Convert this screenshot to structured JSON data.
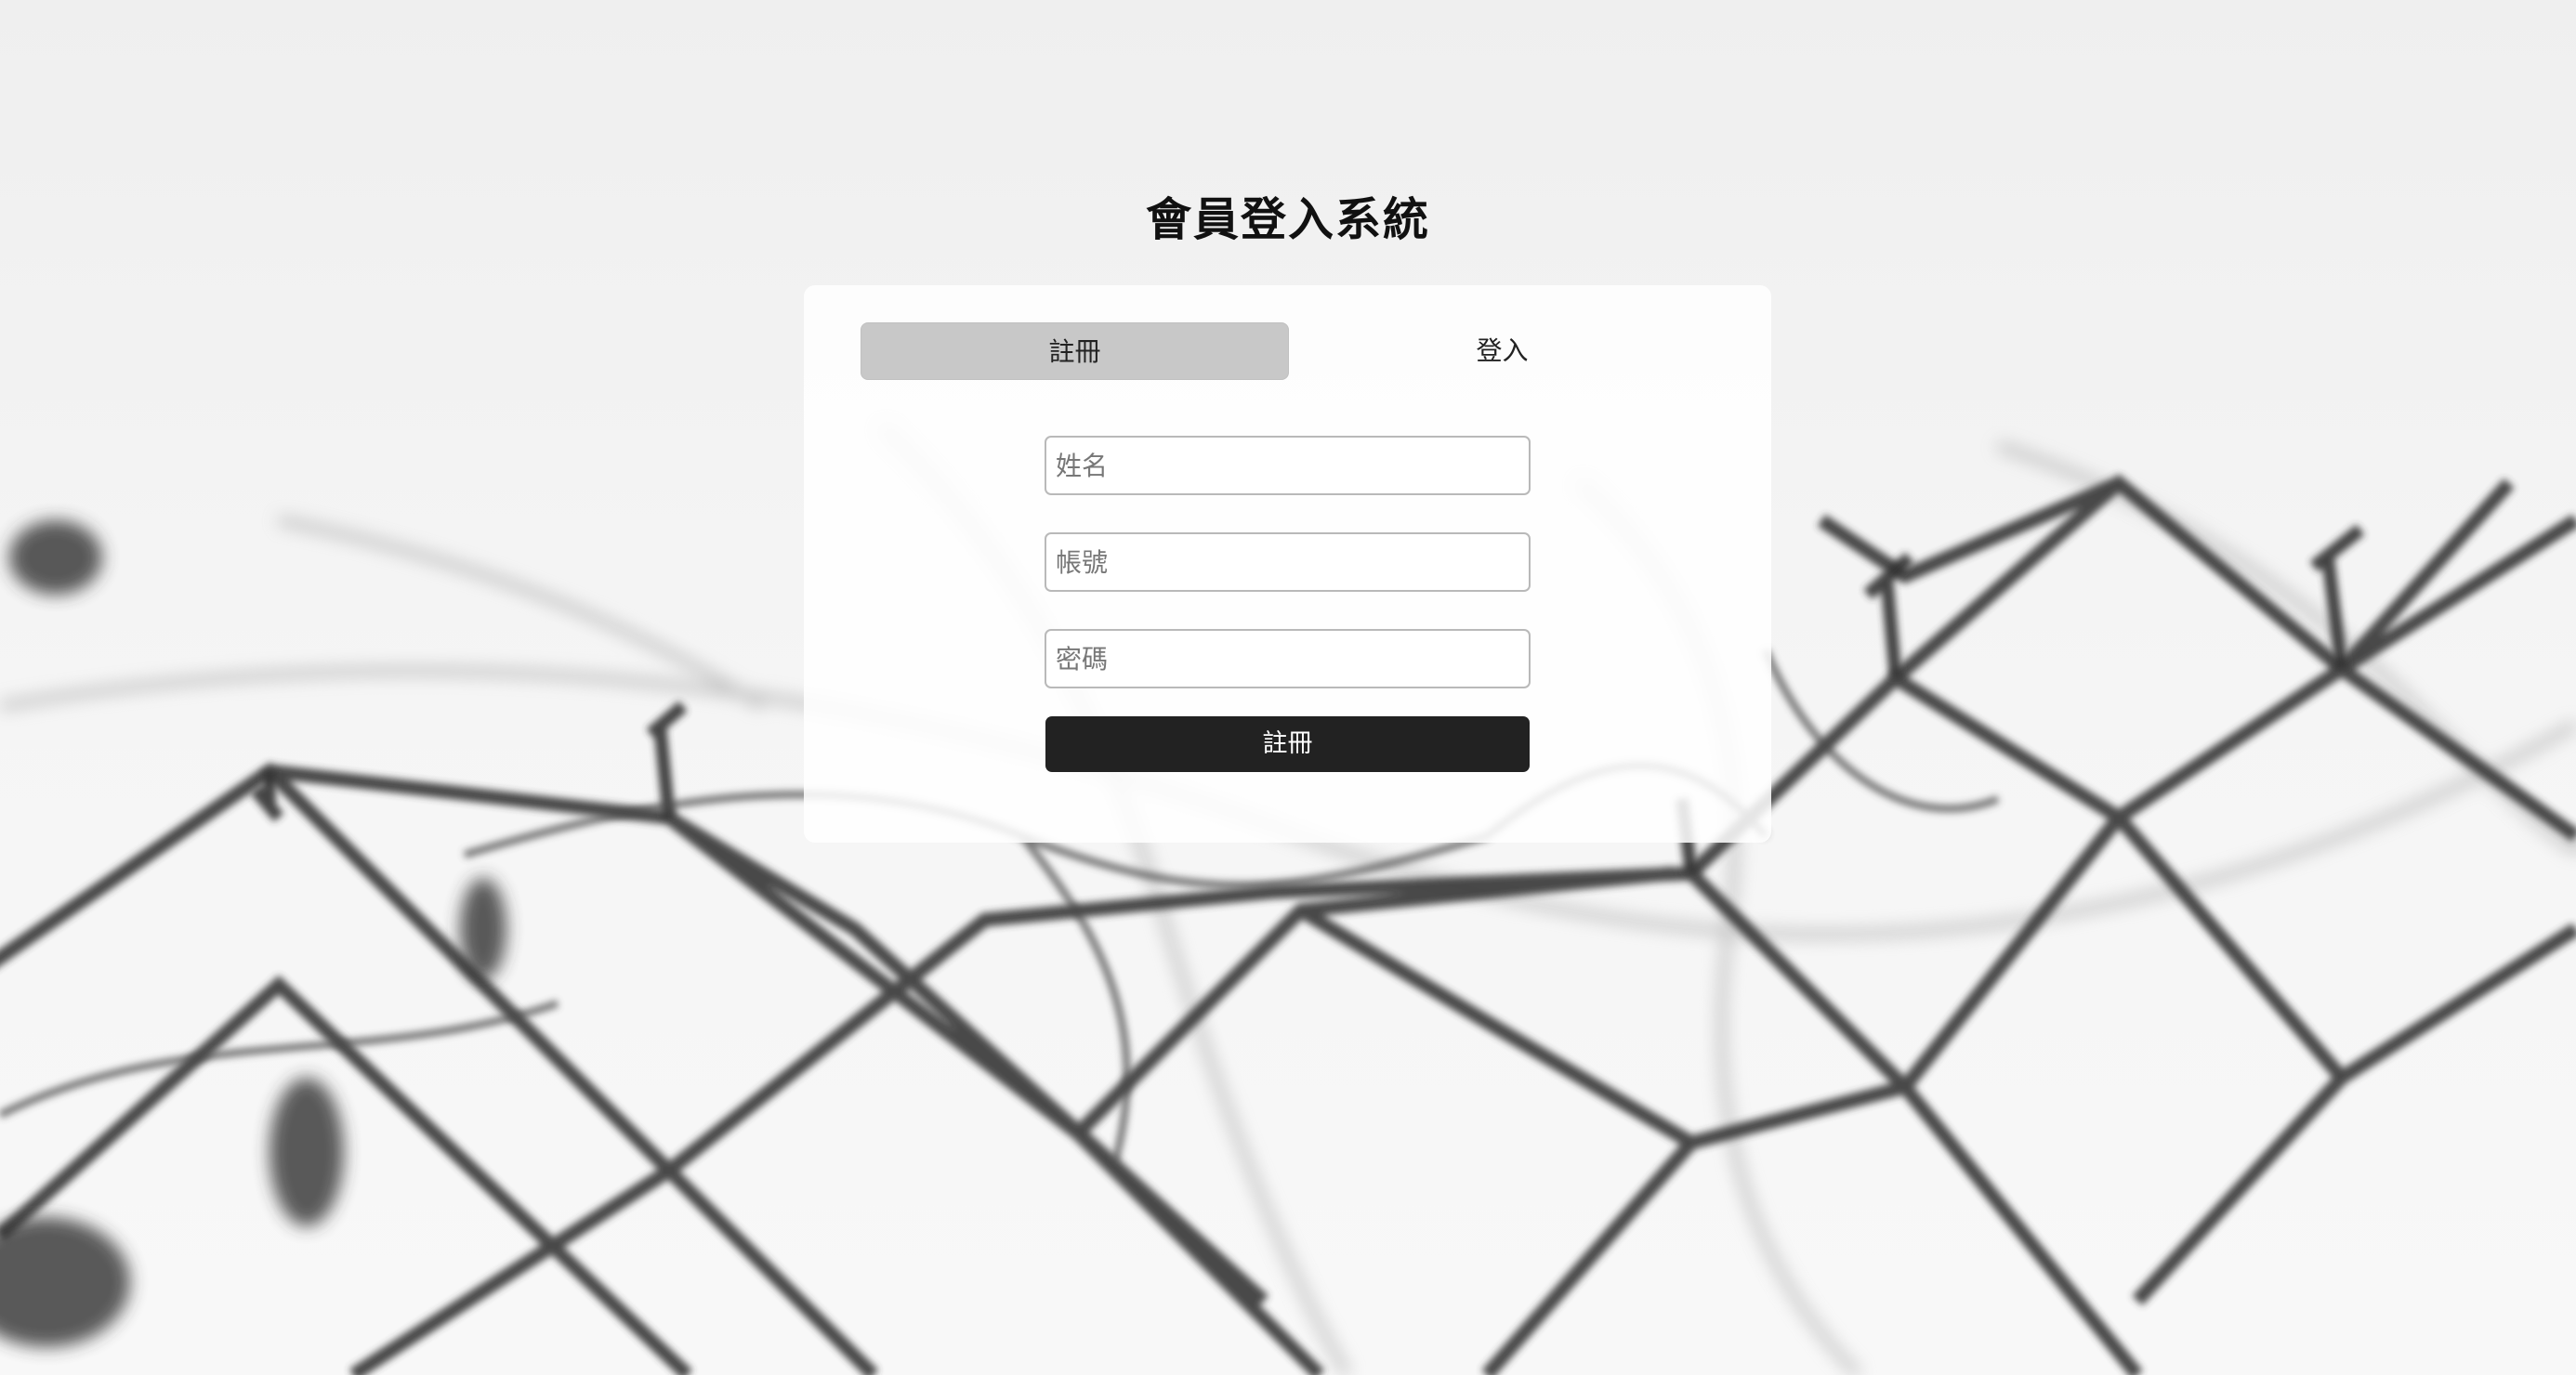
{
  "page": {
    "title": "會員登入系統"
  },
  "tabs": [
    {
      "label": "註冊",
      "active": true
    },
    {
      "label": "登入",
      "active": false
    }
  ],
  "form": {
    "name_placeholder": "姓名",
    "account_placeholder": "帳號",
    "password_placeholder": "密碼",
    "name_value": "",
    "account_value": "",
    "password_value": "",
    "submit_label": "註冊"
  },
  "colors": {
    "active_tab": "#c8c8c8",
    "submit_button": "#222222",
    "card_background": "#ffffff"
  }
}
